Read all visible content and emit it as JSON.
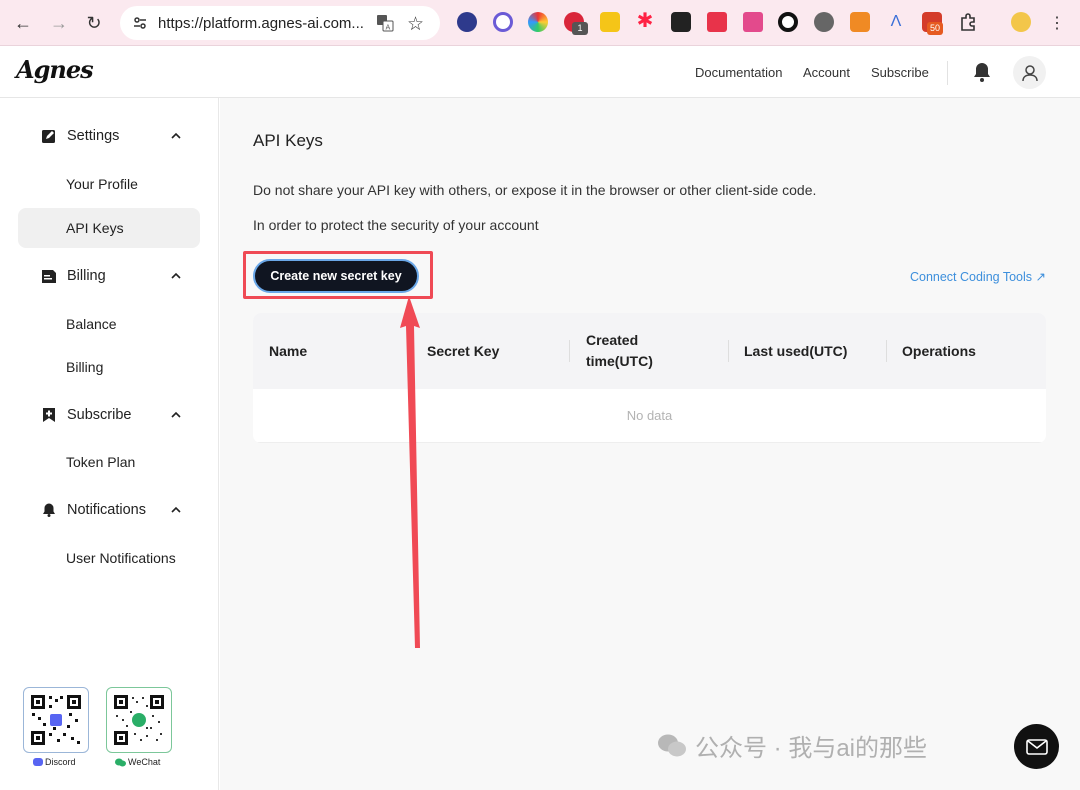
{
  "browser": {
    "url": "https://platform.agnes-ai.com...",
    "extension_badges": [
      "1",
      "50"
    ]
  },
  "header": {
    "logo": "Agnes",
    "links": [
      "Documentation",
      "Account",
      "Subscribe"
    ]
  },
  "sidebar": {
    "sections": [
      {
        "label": "Settings",
        "icon": "edit-icon",
        "items": [
          "Your Profile",
          "API Keys"
        ]
      },
      {
        "label": "Billing",
        "icon": "billing-icon",
        "items": [
          "Balance",
          "Billing"
        ]
      },
      {
        "label": "Subscribe",
        "icon": "bookmark-plus-icon",
        "items": [
          "Token Plan"
        ]
      },
      {
        "label": "Notifications",
        "icon": "bell-icon",
        "items": [
          "User Notifications"
        ]
      }
    ],
    "active_item": "API Keys",
    "community": [
      "Discord",
      "WeChat"
    ]
  },
  "main": {
    "title": "API Keys",
    "description": [
      "Do not share your API key with others, or expose it in the browser or other client-side code.",
      "In order to protect the security of your account"
    ],
    "create_button": "Create new secret key",
    "coding_link": "Connect Coding Tools ↗",
    "table": {
      "columns": [
        "Name",
        "Secret Key",
        "Created time(UTC)",
        "Last used(UTC)",
        "Operations"
      ],
      "empty_text": "No data"
    }
  },
  "watermark": "公众号 · 我与ai的那些",
  "colors": {
    "accent_red": "#ef4a55",
    "button_dark": "#101521",
    "link_blue": "#3d8fdc"
  }
}
